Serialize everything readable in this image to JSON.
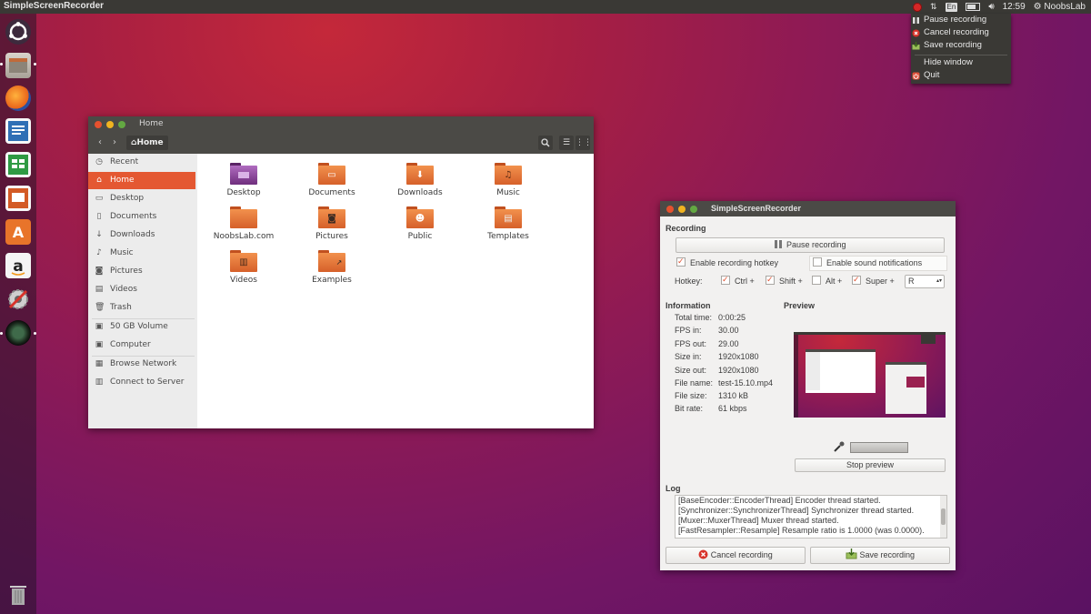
{
  "topbar": {
    "app_title": "SimpleScreenRecorder",
    "keyboard": "En",
    "time": "12:59",
    "user": "NoobsLab"
  },
  "tray_menu": {
    "items": [
      "Pause recording",
      "Cancel recording",
      "Save recording",
      "Hide window",
      "Quit"
    ]
  },
  "launcher": {
    "icons": [
      "ubuntu-icon",
      "files-icon",
      "firefox-icon",
      "writer-icon",
      "calc-icon",
      "impress-icon",
      "software-center-icon",
      "amazon-icon",
      "settings-icon",
      "camera-icon",
      "trash-icon"
    ]
  },
  "file_manager": {
    "title": "Home",
    "breadcrumb": "Home",
    "sidebar": {
      "places": [
        "Recent",
        "Home",
        "Desktop",
        "Documents",
        "Downloads",
        "Music",
        "Pictures",
        "Videos",
        "Trash"
      ],
      "devices": [
        "50 GB Volume",
        "Computer"
      ],
      "network": [
        "Browse Network",
        "Connect to Server"
      ]
    },
    "folders": [
      "Desktop",
      "Documents",
      "Downloads",
      "Music",
      "NoobsLab.com",
      "Pictures",
      "Public",
      "Templates",
      "Videos",
      "Examples"
    ]
  },
  "ssr": {
    "title": "SimpleScreenRecorder",
    "recording_section": "Recording",
    "pause_button": "Pause recording",
    "enable_hotkey": "Enable recording hotkey",
    "enable_sound": "Enable sound notifications",
    "hotkey_label": "Hotkey:",
    "ctrl": "Ctrl +",
    "shift": "Shift +",
    "alt": "Alt +",
    "super": "Super +",
    "key": "R",
    "information_section": "Information",
    "preview_section": "Preview",
    "info": [
      {
        "k": "Total time:",
        "v": "0:00:25"
      },
      {
        "k": "FPS in:",
        "v": "30.00"
      },
      {
        "k": "FPS out:",
        "v": "29.00"
      },
      {
        "k": "Size in:",
        "v": "1920x1080"
      },
      {
        "k": "Size out:",
        "v": "1920x1080"
      },
      {
        "k": "File name:",
        "v": "test-15.10.mp4"
      },
      {
        "k": "File size:",
        "v": "1310 kB"
      },
      {
        "k": "Bit rate:",
        "v": "61 kbps"
      }
    ],
    "stop_preview": "Stop preview",
    "log_section": "Log",
    "log_lines": [
      "[BaseEncoder::EncoderThread] Encoder thread started.",
      "[Synchronizer::SynchronizerThread] Synchronizer thread started.",
      "[Muxer::MuxerThread] Muxer thread started.",
      "[FastResampler::Resample] Resample ratio is 1.0000 (was 0.0000)."
    ],
    "cancel_button": "Cancel recording",
    "save_button": "Save recording"
  },
  "colors": {
    "accent": "#e45832",
    "panel": "#3a3935",
    "titlebar": "#4b4a46",
    "record_red": "#d52727"
  }
}
